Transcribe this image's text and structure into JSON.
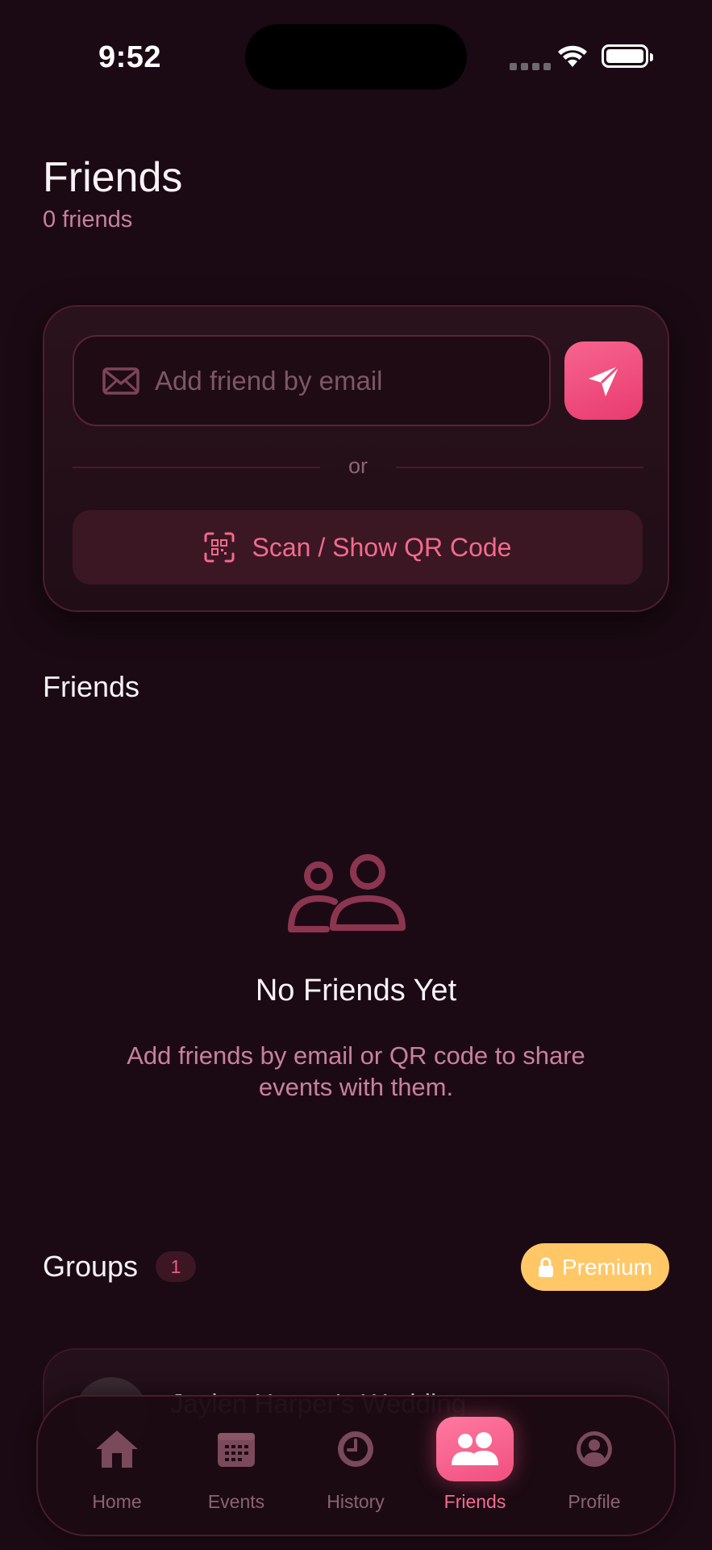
{
  "status_bar": {
    "time": "9:52"
  },
  "header": {
    "title": "Friends",
    "subtitle": "0 friends"
  },
  "add_friend": {
    "email_placeholder": "Add friend by email",
    "divider_text": "or",
    "qr_button_label": "Scan / Show QR Code",
    "icons": {
      "email": "envelope-icon",
      "send": "paper-plane-icon",
      "qr": "qr-scan-icon"
    }
  },
  "friends_section": {
    "title": "Friends",
    "empty_state": {
      "icon": "people-icon",
      "title": "No Friends Yet",
      "description": "Add friends by email or QR code to share events with them."
    }
  },
  "groups_section": {
    "title": "Groups",
    "count": "1",
    "premium_label": "Premium",
    "premium_icon": "lock-icon",
    "groups": [
      {
        "name": "Jaylen  Harper's Wedding"
      }
    ]
  },
  "tab_bar": {
    "tabs": [
      {
        "label": "Home",
        "icon": "house-icon",
        "active": false
      },
      {
        "label": "Events",
        "icon": "calendar-icon",
        "active": false
      },
      {
        "label": "History",
        "icon": "clock-icon",
        "active": false
      },
      {
        "label": "Friends",
        "icon": "people-icon",
        "active": true
      },
      {
        "label": "Profile",
        "icon": "person-circle-icon",
        "active": false
      }
    ]
  },
  "colors": {
    "background": "#1b0a13",
    "accent": "#f0507f",
    "muted_text": "#c9809e",
    "premium": "#ffc766"
  }
}
